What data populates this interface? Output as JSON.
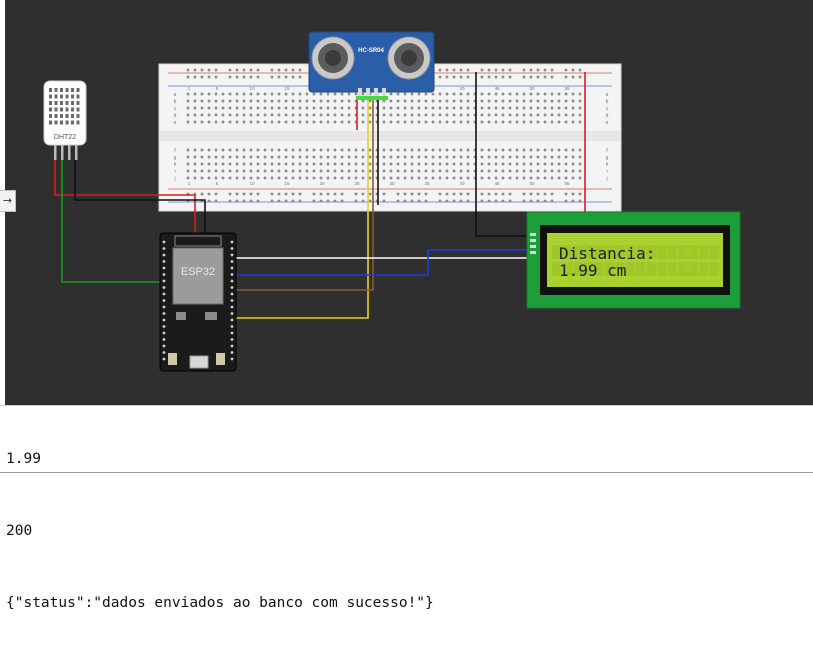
{
  "simulator": {
    "sidebar_toggle_glyph": "→",
    "colors": {
      "workspace": "#2f2f2f",
      "wire_red": "#d32020",
      "wire_black": "#111111",
      "wire_green": "#1a9b1a",
      "wire_yellow": "#e8d21e",
      "wire_blue": "#1a3fd6",
      "wire_white": "#ffffff",
      "wire_brown": "#8a5a2b",
      "lcd_backlight": "#a9d12f",
      "lcd_board": "#1e9e3a"
    },
    "components": {
      "dht22": {
        "label": "DHT22"
      },
      "hcsr04": {
        "label": "HC-SR04"
      },
      "esp32": {
        "label": "ESP32"
      },
      "lcd": {
        "line1": "Distancia:",
        "line2": "1.99 cm"
      },
      "breadboard": {
        "column_numbers": [
          "1",
          "5",
          "10",
          "15",
          "20",
          "25",
          "30",
          "35",
          "40",
          "45",
          "50",
          "55"
        ],
        "row_letters_top": [
          "a",
          "b",
          "c",
          "d",
          "e"
        ],
        "row_letters_bottom": [
          "f",
          "g",
          "h",
          "i",
          "j"
        ]
      }
    }
  },
  "console": {
    "lines": [
      "1.99",
      "200",
      "{\"status\":\"dados enviados ao banco com sucesso!\"}"
    ]
  }
}
